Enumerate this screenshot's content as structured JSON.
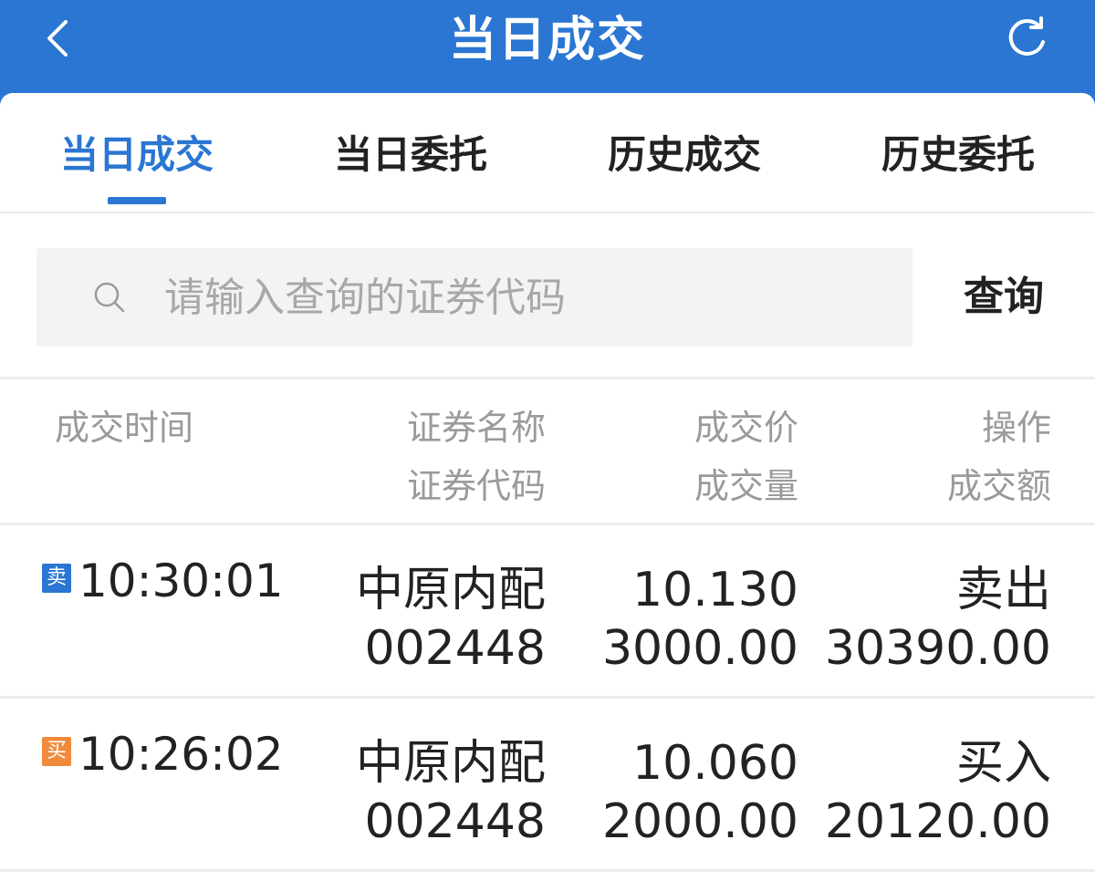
{
  "header": {
    "title": "当日成交"
  },
  "tabs": [
    {
      "label": "当日成交",
      "active": true
    },
    {
      "label": "当日委托",
      "active": false
    },
    {
      "label": "历史成交",
      "active": false
    },
    {
      "label": "历史委托",
      "active": false
    }
  ],
  "search": {
    "placeholder": "请输入查询的证券代码",
    "value": "",
    "button_label": "查询"
  },
  "table": {
    "headers": {
      "time": "成交时间",
      "name": "证券名称",
      "code": "证券代码",
      "price": "成交价",
      "volume": "成交量",
      "action": "操作",
      "amount": "成交额"
    },
    "rows": [
      {
        "badge": "卖",
        "badge_color": "#2a76d2",
        "time": "10:30:01",
        "name": "中原内配",
        "code": "002448",
        "price": "10.130",
        "volume": "3000.00",
        "action": "卖出",
        "amount": "30390.00"
      },
      {
        "badge": "买",
        "badge_color": "#f08a3c",
        "time": "10:26:02",
        "name": "中原内配",
        "code": "002448",
        "price": "10.060",
        "volume": "2000.00",
        "action": "买入",
        "amount": "20120.00"
      }
    ]
  },
  "colors": {
    "primary": "#2a76d2",
    "buy_badge": "#f08a3c",
    "sell_badge": "#2a76d2"
  },
  "icons": {
    "back": "chevron-left-icon",
    "refresh": "refresh-icon",
    "search": "search-icon"
  }
}
